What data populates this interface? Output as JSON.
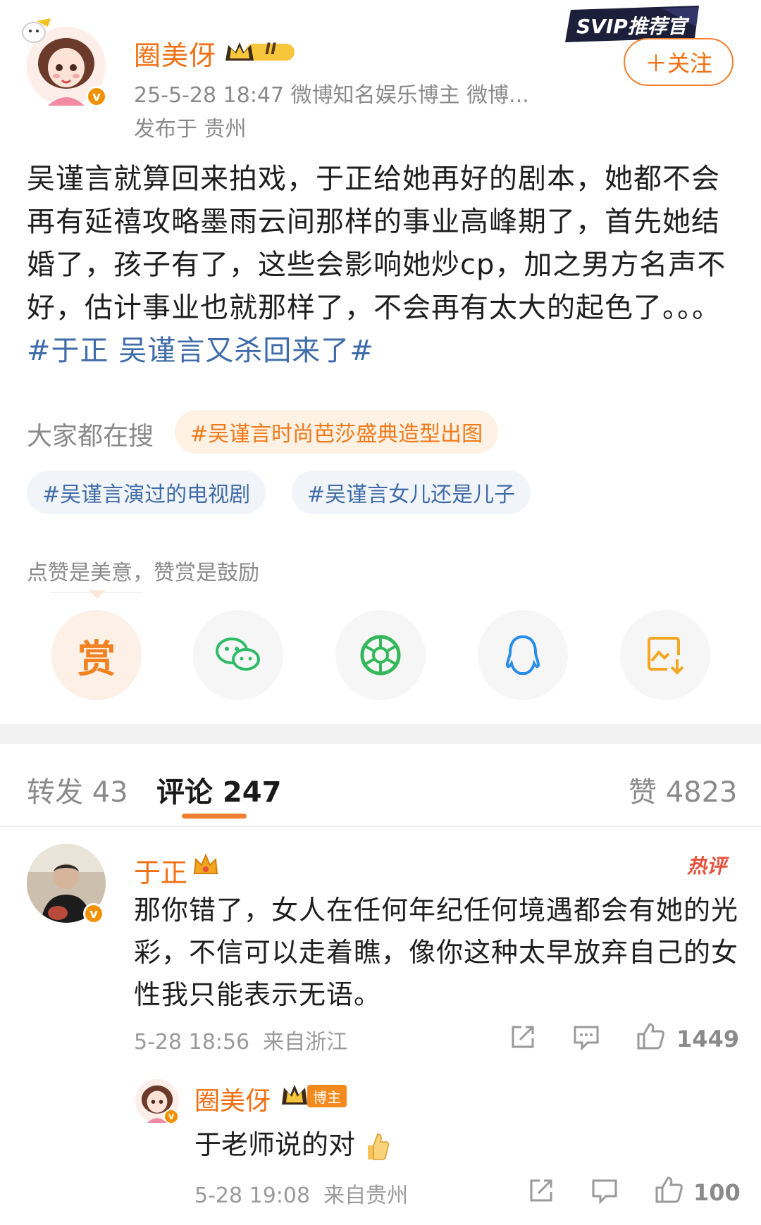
{
  "post": {
    "author": "圈美伢",
    "level_badge": "II",
    "meta": "25-5-28 18:47  微博知名娱乐博主 微博...",
    "location": "发布于 贵州",
    "follow_label": "＋关注",
    "svip_banner": "SVIP推荐官",
    "body_text": "吴谨言就算回来拍戏，于正给她再好的剧本，她都不会再有延禧攻略墨雨云间那样的事业高峰期了，首先她结婚了，孩子有了，这些会影响她炒cp，加之男方名声不好，估计事业也就那样了，不会再有太大的起色了。。。",
    "hashtag": "#于正 吴谨言又杀回来了#"
  },
  "search": {
    "label": "大家都在搜",
    "chips": [
      "#吴谨言时尚芭莎盛典造型出图",
      "#吴谨言演过的电视剧",
      "#吴谨言女儿还是儿子"
    ]
  },
  "reward": {
    "tip": "点赞是美意，赞赏是鼓励",
    "reward_label": "赏",
    "share_icons": [
      "wechat-icon",
      "moments-icon",
      "qq-icon",
      "save-image-icon"
    ]
  },
  "tabs": {
    "repost": "转发 43",
    "comment": "评论 247",
    "like": "赞 4823"
  },
  "colors": {
    "accent": "#f36f12",
    "hashtag": "#3f6ca8",
    "hot": "#e8503c"
  },
  "comments": [
    {
      "author": "于正",
      "hot_tag": "热评",
      "text": "那你错了，女人在任何年纪任何境遇都会有她的光彩，不信可以走着瞧，像你这种太早放弃自己的女性我只能表示无语。",
      "time": "5-28 18:56",
      "location": "来自浙江",
      "likes": "1449"
    }
  ],
  "reply": {
    "author": "圈美伢",
    "badge": "博主",
    "text": "于老师说的对",
    "time": "5-28 19:08",
    "location": "来自贵州",
    "likes": "100"
  }
}
